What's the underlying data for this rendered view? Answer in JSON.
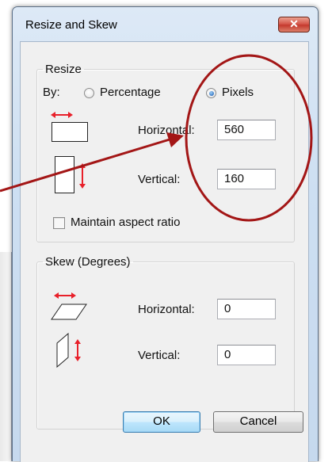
{
  "window": {
    "title": "Resize and Skew",
    "close_glyph": "✕"
  },
  "resize": {
    "title": "Resize",
    "by_label": "By:",
    "options": [
      {
        "label": "Percentage",
        "selected": false
      },
      {
        "label": "Pixels",
        "selected": true
      }
    ],
    "horizontal": {
      "label": "Horizontal:",
      "value": "560",
      "icon": "resize-horizontal-icon"
    },
    "vertical": {
      "label": "Vertical:",
      "value": "160",
      "icon": "resize-vertical-icon"
    },
    "maintain_aspect": {
      "label": "Maintain aspect ratio",
      "checked": false
    }
  },
  "skew": {
    "title": "Skew (Degrees)",
    "horizontal": {
      "label": "Horizontal:",
      "value": "0",
      "icon": "skew-horizontal-icon"
    },
    "vertical": {
      "label": "Vertical:",
      "value": "0",
      "icon": "skew-vertical-icon"
    }
  },
  "buttons": {
    "ok": "OK",
    "cancel": "Cancel"
  },
  "colors": {
    "arrow_red": "#e8202a",
    "annotation_red": "#a31616",
    "focus_blue": "#3c7fb1"
  }
}
